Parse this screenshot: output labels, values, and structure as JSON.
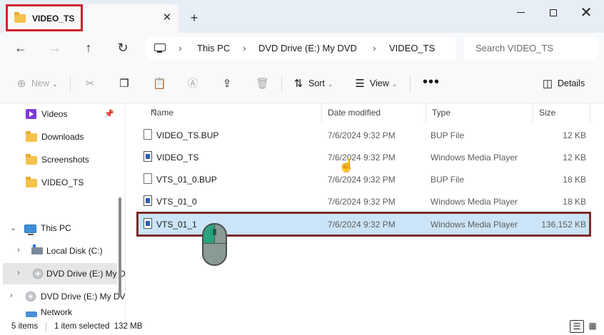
{
  "window": {
    "tab_title": "VIDEO_TS",
    "close_tab": "✕",
    "new_tab": "+",
    "minimize": "",
    "maximize": "",
    "close": "✕"
  },
  "nav": {
    "back": "←",
    "forward": "→",
    "up": "↑",
    "refresh": "↻"
  },
  "breadcrumb": [
    "This PC",
    "DVD Drive (E:) My DVD",
    "VIDEO_TS"
  ],
  "breadcrumb_sep": "›",
  "search": {
    "placeholder": "Search VIDEO_TS"
  },
  "toolbar": {
    "new_label": "New",
    "cut_icon": "scissors-icon",
    "copy_icon": "copy-icon",
    "paste_icon": "paste-icon",
    "rename_icon": "rename-icon",
    "share_icon": "share-icon",
    "delete_icon": "trash-icon",
    "sort_label": "Sort",
    "view_label": "View",
    "more_label": "•••",
    "details_label": "Details"
  },
  "sidebar": {
    "quick": [
      {
        "label": "Videos",
        "pinned": true
      },
      {
        "label": "Downloads"
      },
      {
        "label": "Screenshots"
      },
      {
        "label": "VIDEO_TS"
      }
    ],
    "this_pc": "This PC",
    "drives": [
      {
        "label": "Local Disk (C:)"
      },
      {
        "label": "DVD Drive (E:) My DVD",
        "selected": true
      }
    ],
    "root_drive": "DVD Drive (E:) My DVD",
    "network": "Network"
  },
  "columns": {
    "name": "Name",
    "date": "Date modified",
    "type": "Type",
    "size": "Size"
  },
  "files": [
    {
      "name": "VIDEO_TS.BUP",
      "date": "7/6/2024 9:32 PM",
      "type": "BUP File",
      "size": "12 KB",
      "icon": "file-icon"
    },
    {
      "name": "VIDEO_TS",
      "date": "7/6/2024 9:32 PM",
      "type": "Windows Media Player",
      "size": "12 KB",
      "icon": "media-file-icon"
    },
    {
      "name": "VTS_01_0.BUP",
      "date": "7/6/2024 9:32 PM",
      "type": "BUP File",
      "size": "18 KB",
      "icon": "file-icon"
    },
    {
      "name": "VTS_01_0",
      "date": "7/6/2024 9:32 PM",
      "type": "Windows Media Player",
      "size": "18 KB",
      "icon": "media-file-icon"
    },
    {
      "name": "VTS_01_1",
      "date": "7/6/2024 9:32 PM",
      "type": "Windows Media Player",
      "size": "136,152 KB",
      "icon": "media-file-icon",
      "selected": true
    }
  ],
  "status": {
    "item_count": "5 items",
    "selection": "1 item selected  132 MB"
  },
  "colors": {
    "highlight_red": "#d0202a",
    "row_outline": "#7b2a2a",
    "selected_row": "#cce4f7",
    "mouse_button": "#2aa37f"
  }
}
